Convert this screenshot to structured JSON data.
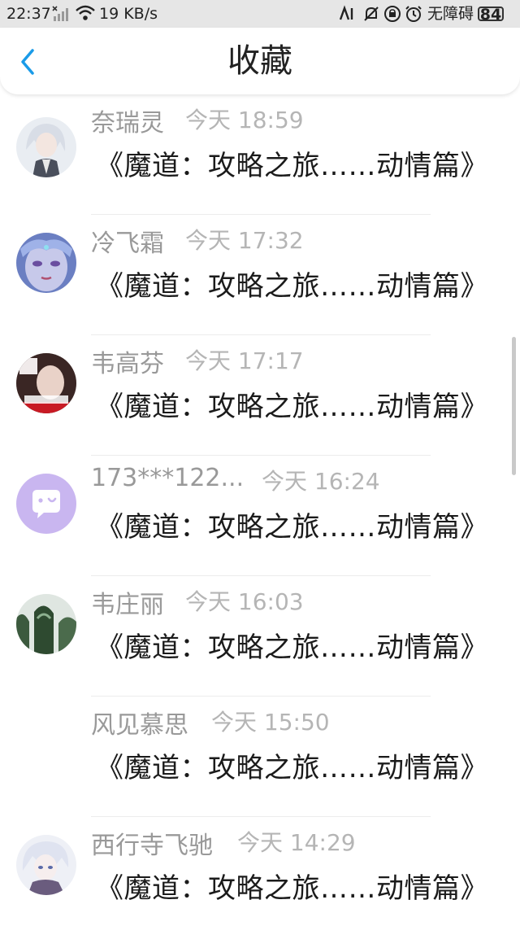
{
  "status_bar": {
    "time": "22:37",
    "network_speed": "19 KB/s",
    "accessibility": "无障碍",
    "battery": "84"
  },
  "header": {
    "title": "收藏"
  },
  "favorites": [
    {
      "user": "奈瑞灵",
      "time": "今天 18:59",
      "content": "《魔道：攻略之旅……动情篇》",
      "avatar": "anime-silver-hair"
    },
    {
      "user": "冷飞霜",
      "time": "今天 17:32",
      "content": "《魔道：攻略之旅……动情篇》",
      "avatar": "elf-face"
    },
    {
      "user": "韦高芬",
      "time": "今天 17:17",
      "content": "《魔道：攻略之旅……动情篇》",
      "avatar": "girl-photo"
    },
    {
      "user": "173***122...",
      "time": "今天 16:24",
      "content": "《魔道：攻略之旅……动情篇》",
      "avatar": "default-chat"
    },
    {
      "user": "韦庄丽",
      "time": "今天 16:03",
      "content": "《魔道：攻略之旅……动情篇》",
      "avatar": "mountain-landscape"
    },
    {
      "user": "风见慕思",
      "time": "今天 15:50",
      "content": "《魔道：攻略之旅……动情篇》",
      "avatar": "none"
    },
    {
      "user": "西行寺飞驰",
      "time": "今天 14:29",
      "content": "《魔道：攻略之旅……动情篇》",
      "avatar": "anime-white-hair"
    }
  ],
  "colors": {
    "accent": "#1a9be8",
    "default_avatar_bg": "#c9b6f0"
  }
}
